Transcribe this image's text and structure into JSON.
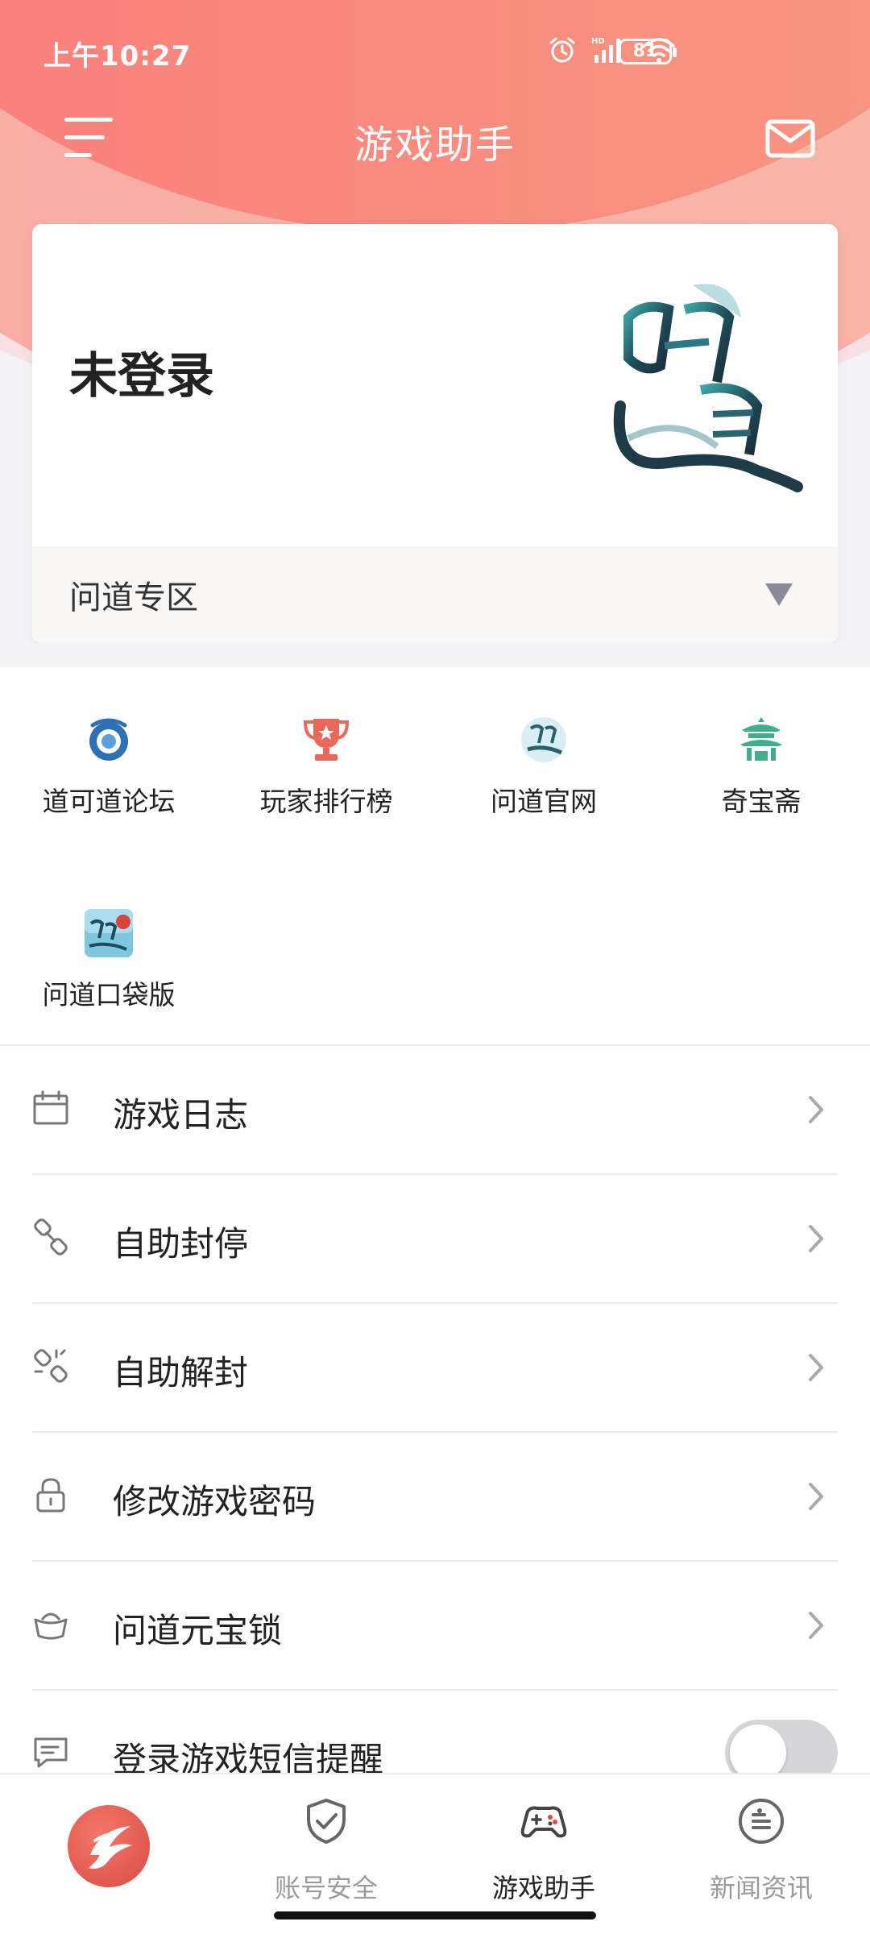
{
  "status_bar": {
    "time": "上午10:27",
    "battery": "81",
    "network": "HD"
  },
  "header": {
    "title": "游戏助手"
  },
  "account_card": {
    "status": "未登录",
    "zone_label": "问道专区"
  },
  "quick_links": [
    {
      "label": "道可道论坛",
      "icon": "forum-icon"
    },
    {
      "label": "玩家排行榜",
      "icon": "trophy-icon"
    },
    {
      "label": "问道官网",
      "icon": "website-icon"
    },
    {
      "label": "奇宝斋",
      "icon": "pavilion-icon"
    },
    {
      "label": "问道口袋版",
      "icon": "pocket-edition-icon"
    }
  ],
  "menu": [
    {
      "label": "游戏日志",
      "icon": "calendar-icon"
    },
    {
      "label": "自助封停",
      "icon": "link-icon"
    },
    {
      "label": "自助解封",
      "icon": "unlink-icon"
    },
    {
      "label": "修改游戏密码",
      "icon": "lock-icon"
    },
    {
      "label": "问道元宝锁",
      "icon": "ingot-icon"
    },
    {
      "label": "登录游戏短信提醒",
      "icon": "message-icon",
      "toggle": false
    }
  ],
  "bottom_nav": [
    {
      "label": "",
      "icon": "app-logo"
    },
    {
      "label": "账号安全",
      "icon": "shield-icon"
    },
    {
      "label": "游戏助手",
      "icon": "gamepad-icon",
      "active": true
    },
    {
      "label": "新闻资讯",
      "icon": "news-icon"
    }
  ],
  "colors": {
    "header_red": "#fa7e7c",
    "header_pink": "#f8aaa4",
    "trophy": "#e8685c",
    "pavilion": "#3fae8a",
    "forum_blue": "#2f6fb5"
  }
}
